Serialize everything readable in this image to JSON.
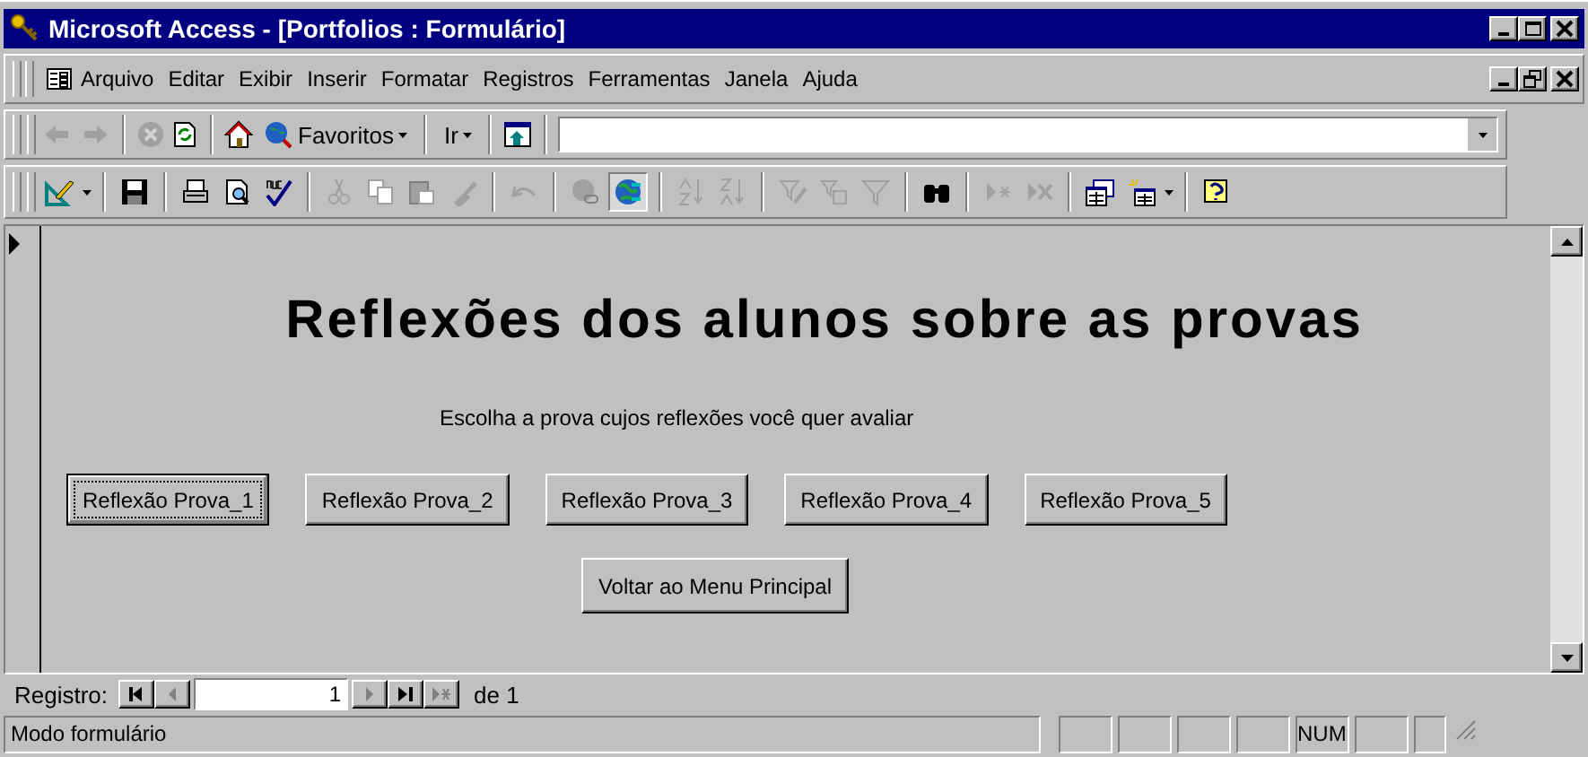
{
  "window": {
    "title": "Microsoft Access - [Portfolios : Formulário]"
  },
  "menu": [
    "Arquivo",
    "Editar",
    "Exibir",
    "Inserir",
    "Formatar",
    "Registros",
    "Ferramentas",
    "Janela",
    "Ajuda"
  ],
  "web_toolbar": {
    "favorites": "Favoritos",
    "go": "Ir"
  },
  "form": {
    "title": "Reflexões dos alunos sobre as provas",
    "instruction": "Escolha a prova cujos reflexões você quer avaliar",
    "buttons": [
      {
        "label": "Reflexão Prova_1",
        "focused": true
      },
      {
        "label": "Reflexão Prova_2",
        "focused": false
      },
      {
        "label": "Reflexão Prova_3",
        "focused": false
      },
      {
        "label": "Reflexão Prova_4",
        "focused": false
      },
      {
        "label": "Reflexão Prova_5",
        "focused": false
      }
    ],
    "menu_button": "Voltar ao Menu Principal"
  },
  "navigation": {
    "label": "Registro:",
    "record": "1",
    "of": "de 1"
  },
  "status_bar": {
    "mode": "Modo formulário",
    "indicator": "NUM"
  }
}
